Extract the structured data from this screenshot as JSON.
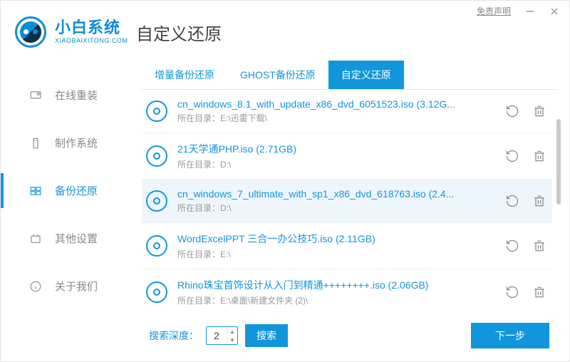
{
  "titlebar": {
    "disclaimer": "免责声明"
  },
  "brand": {
    "name": "小白系统",
    "domain": "XIAOBAIXITONG.COM"
  },
  "page_title": "自定义还原",
  "sidebar": {
    "items": [
      {
        "label": "在线重装"
      },
      {
        "label": "制作系统"
      },
      {
        "label": "备份还原"
      },
      {
        "label": "其他设置"
      },
      {
        "label": "关于我们"
      }
    ]
  },
  "tabs": {
    "items": [
      {
        "label": "增量备份还原"
      },
      {
        "label": "GHOST备份还原"
      },
      {
        "label": "自定义还原"
      }
    ]
  },
  "path_label_prefix": "所在目录：",
  "list": [
    {
      "title": "cn_windows_8.1_with_update_x86_dvd_6051523.iso (3.12G...",
      "path": "E:\\迅雷下载\\"
    },
    {
      "title": "21天学通PHP.iso (2.71GB)",
      "path": "D:\\"
    },
    {
      "title": "cn_windows_7_ultimate_with_sp1_x86_dvd_618763.iso (2.4...",
      "path": "D:\\"
    },
    {
      "title": "WordExcelPPT 三合一办公技巧.iso (2.11GB)",
      "path": "E:\\"
    },
    {
      "title": "Rhino珠宝首饰设计从入门到精通++++++++.iso (2.06GB)",
      "path": "E:\\桌面\\新建文件夹 (2)\\"
    }
  ],
  "footer": {
    "depth_label": "搜索深度：",
    "depth_value": "2",
    "search_label": "搜索",
    "next_label": "下一步"
  }
}
